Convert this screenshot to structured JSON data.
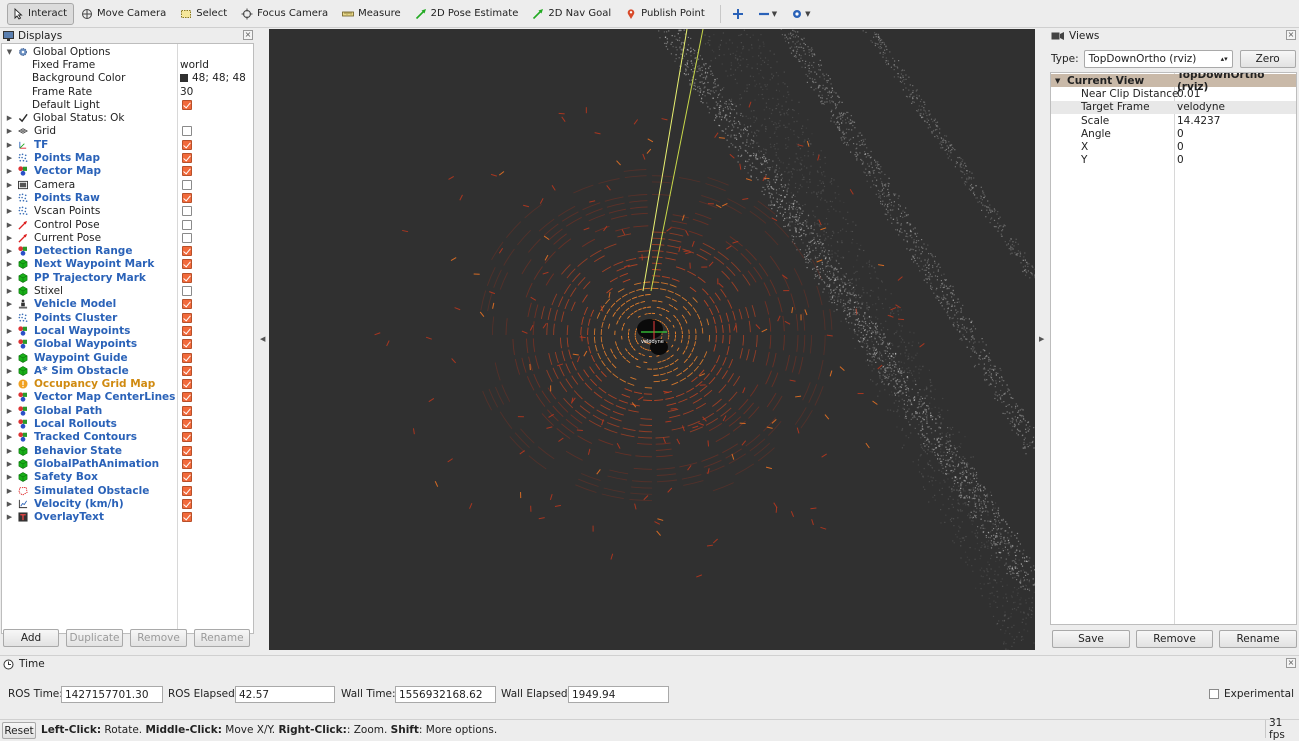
{
  "toolbar": {
    "tools": [
      {
        "label": "Interact",
        "icon": "cursor-icon",
        "active": true
      },
      {
        "label": "Move Camera",
        "icon": "move-camera-icon"
      },
      {
        "label": "Select",
        "icon": "select-box-icon"
      },
      {
        "label": "Focus Camera",
        "icon": "focus-target-icon"
      },
      {
        "label": "Measure",
        "icon": "ruler-icon"
      },
      {
        "label": "2D Pose Estimate",
        "icon": "green-arrow-icon"
      },
      {
        "label": "2D Nav Goal",
        "icon": "green-arrow-icon"
      },
      {
        "label": "Publish Point",
        "icon": "map-pin-icon"
      }
    ]
  },
  "displays": {
    "title": "Displays",
    "global_options": {
      "label": "Global Options",
      "props": [
        {
          "key": "Fixed Frame",
          "value": "world"
        },
        {
          "key": "Background Color",
          "value": "48; 48; 48",
          "swatch": "#303030"
        },
        {
          "key": "Frame Rate",
          "value": "30"
        },
        {
          "key": "Default Light",
          "checked": true
        }
      ]
    },
    "global_status": "Global Status: Ok",
    "items": [
      {
        "label": "Grid",
        "checked": false,
        "style": "plain",
        "icon": "grid-icon"
      },
      {
        "label": "TF",
        "checked": true,
        "style": "link",
        "icon": "tf-axes-icon"
      },
      {
        "label": "Points Map",
        "checked": true,
        "style": "link",
        "icon": "point-cloud-icon"
      },
      {
        "label": "Vector Map",
        "checked": true,
        "style": "link",
        "icon": "marker-array-icon"
      },
      {
        "label": "Camera",
        "checked": false,
        "style": "plain",
        "icon": "camera-icon"
      },
      {
        "label": "Points Raw",
        "checked": true,
        "style": "link",
        "icon": "point-cloud-icon"
      },
      {
        "label": "Vscan Points",
        "checked": false,
        "style": "plain",
        "icon": "point-cloud-icon"
      },
      {
        "label": "Control Pose",
        "checked": false,
        "style": "plain",
        "icon": "pose-arrow-icon"
      },
      {
        "label": "Current Pose",
        "checked": false,
        "style": "plain",
        "icon": "pose-arrow-icon"
      },
      {
        "label": "Detection Range",
        "checked": true,
        "style": "link",
        "icon": "marker-array-icon"
      },
      {
        "label": "Next Waypoint Mark",
        "checked": true,
        "style": "link",
        "icon": "marker-icon"
      },
      {
        "label": "PP Trajectory Mark",
        "checked": true,
        "style": "link",
        "icon": "marker-icon"
      },
      {
        "label": "Stixel",
        "checked": false,
        "style": "plain",
        "icon": "marker-icon"
      },
      {
        "label": "Vehicle Model",
        "checked": true,
        "style": "link",
        "icon": "robot-model-icon"
      },
      {
        "label": "Points Cluster",
        "checked": true,
        "style": "link",
        "icon": "point-cloud-icon"
      },
      {
        "label": "Local Waypoints",
        "checked": true,
        "style": "link",
        "icon": "marker-array-icon"
      },
      {
        "label": "Global Waypoints",
        "checked": true,
        "style": "link",
        "icon": "marker-array-icon"
      },
      {
        "label": "Waypoint Guide",
        "checked": true,
        "style": "link",
        "icon": "marker-icon"
      },
      {
        "label": "A* Sim Obstacle",
        "checked": true,
        "style": "link",
        "icon": "marker-icon"
      },
      {
        "label": "Occupancy Grid Map",
        "checked": true,
        "style": "warn",
        "icon": "warning-icon"
      },
      {
        "label": "Vector Map CenterLines",
        "checked": true,
        "style": "link",
        "icon": "marker-array-icon"
      },
      {
        "label": "Global Path",
        "checked": true,
        "style": "link",
        "icon": "marker-array-icon"
      },
      {
        "label": "Local Rollouts",
        "checked": true,
        "style": "link",
        "icon": "marker-array-icon"
      },
      {
        "label": "Tracked Contours",
        "checked": true,
        "style": "link",
        "icon": "marker-array-icon"
      },
      {
        "label": "Behavior State",
        "checked": true,
        "style": "link",
        "icon": "marker-icon"
      },
      {
        "label": "GlobalPathAnimation",
        "checked": true,
        "style": "link",
        "icon": "marker-icon"
      },
      {
        "label": "Safety Box",
        "checked": true,
        "style": "link",
        "icon": "marker-icon"
      },
      {
        "label": "Simulated Obstacle",
        "checked": true,
        "style": "link",
        "icon": "polygon-icon"
      },
      {
        "label": "Velocity (km/h)",
        "checked": true,
        "style": "link",
        "icon": "chart-icon"
      },
      {
        "label": "OverlayText",
        "checked": true,
        "style": "link",
        "icon": "text-icon"
      }
    ],
    "buttons": {
      "add": "Add",
      "duplicate": "Duplicate",
      "remove": "Remove",
      "rename": "Rename"
    }
  },
  "views": {
    "title": "Views",
    "type_label": "Type:",
    "type_value": "TopDownOrtho (rviz)",
    "zero_label": "Zero",
    "current_view_label": "Current View",
    "current_view_value": "TopDownOrtho (rviz)",
    "props": [
      {
        "key": "Near Clip Distance",
        "value": "0.01"
      },
      {
        "key": "Target Frame",
        "value": "velodyne"
      },
      {
        "key": "Scale",
        "value": "14.4237"
      },
      {
        "key": "Angle",
        "value": "0"
      },
      {
        "key": "X",
        "value": "0"
      },
      {
        "key": "Y",
        "value": "0"
      }
    ],
    "buttons": {
      "save": "Save",
      "remove": "Remove",
      "rename": "Rename"
    }
  },
  "viewport": {
    "vehicle_label": "velodyne",
    "background": "#303030"
  },
  "time": {
    "title": "Time",
    "ros_time_label": "ROS Time:",
    "ros_time": "1427157701.30",
    "ros_elapsed_label": "ROS Elapsed:",
    "ros_elapsed": "42.57",
    "wall_time_label": "Wall Time:",
    "wall_time": "1556932168.62",
    "wall_elapsed_label": "Wall Elapsed:",
    "wall_elapsed": "1949.94",
    "experimental_label": "Experimental"
  },
  "status": {
    "reset_label": "Reset",
    "b1": "Left-Click:",
    "t1": " Rotate. ",
    "b2": "Middle-Click:",
    "t2": " Move X/Y. ",
    "b3": "Right-Click:",
    "t3": ": Zoom. ",
    "b4": "Shift",
    "t4": ": More options.",
    "fps": "31 fps"
  }
}
